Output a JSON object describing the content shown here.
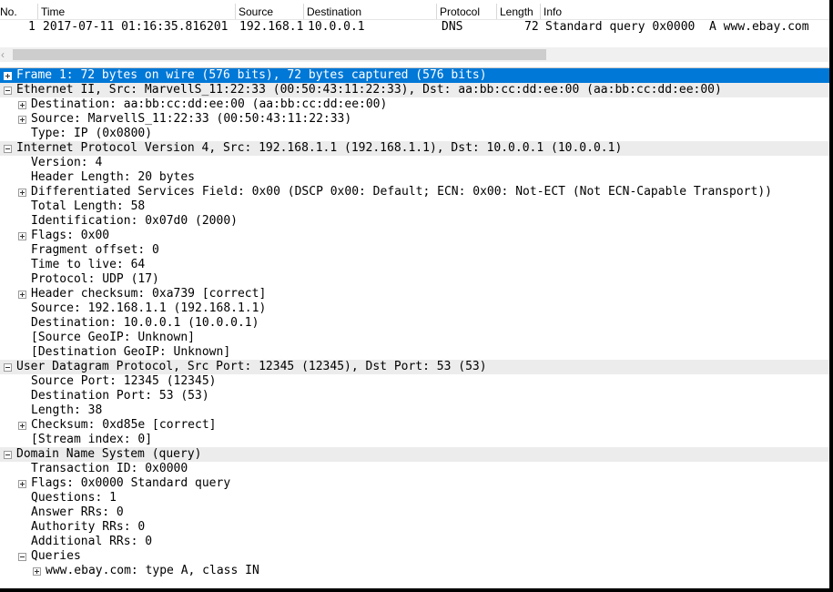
{
  "packet_list": {
    "columns": [
      "No.",
      "Time",
      "Source",
      "Destination",
      "Protocol",
      "Length",
      "Info"
    ],
    "row": {
      "no": "1",
      "time": "2017-07-11 01:16:35.816201",
      "source": "192.168.1.1",
      "destination": "10.0.0.1",
      "protocol": "DNS",
      "length": "72",
      "info": "Standard query 0x0000  A www.ebay.com"
    }
  },
  "scrollbar": {
    "left_arrow": "‹"
  },
  "details": [
    {
      "text": "Frame 1: 72 bytes on wire (576 bits), 72 bytes captured (576 bits)",
      "toggle": "plus",
      "level": 0,
      "selected": true
    },
    {
      "text": "Ethernet II, Src: MarvellS_11:22:33 (00:50:43:11:22:33), Dst: aa:bb:cc:dd:ee:00 (aa:bb:cc:dd:ee:00)",
      "toggle": "minus",
      "level": 0
    },
    {
      "text": "Destination: aa:bb:cc:dd:ee:00 (aa:bb:cc:dd:ee:00)",
      "toggle": "plus",
      "level": 1
    },
    {
      "text": "Source: MarvellS_11:22:33 (00:50:43:11:22:33)",
      "toggle": "plus",
      "level": 1
    },
    {
      "text": "Type: IP (0x0800)",
      "toggle": "none",
      "level": 1
    },
    {
      "text": "Internet Protocol Version 4, Src: 192.168.1.1 (192.168.1.1), Dst: 10.0.0.1 (10.0.0.1)",
      "toggle": "minus",
      "level": 0
    },
    {
      "text": "Version: 4",
      "toggle": "none",
      "level": 1
    },
    {
      "text": "Header Length: 20 bytes",
      "toggle": "none",
      "level": 1
    },
    {
      "text": "Differentiated Services Field: 0x00 (DSCP 0x00: Default; ECN: 0x00: Not-ECT (Not ECN-Capable Transport))",
      "toggle": "plus",
      "level": 1
    },
    {
      "text": "Total Length: 58",
      "toggle": "none",
      "level": 1
    },
    {
      "text": "Identification: 0x07d0 (2000)",
      "toggle": "none",
      "level": 1
    },
    {
      "text": "Flags: 0x00",
      "toggle": "plus",
      "level": 1
    },
    {
      "text": "Fragment offset: 0",
      "toggle": "none",
      "level": 1
    },
    {
      "text": "Time to live: 64",
      "toggle": "none",
      "level": 1
    },
    {
      "text": "Protocol: UDP (17)",
      "toggle": "none",
      "level": 1
    },
    {
      "text": "Header checksum: 0xa739 [correct]",
      "toggle": "plus",
      "level": 1
    },
    {
      "text": "Source: 192.168.1.1 (192.168.1.1)",
      "toggle": "none",
      "level": 1
    },
    {
      "text": "Destination: 10.0.0.1 (10.0.0.1)",
      "toggle": "none",
      "level": 1
    },
    {
      "text": "[Source GeoIP: Unknown]",
      "toggle": "none",
      "level": 1
    },
    {
      "text": "[Destination GeoIP: Unknown]",
      "toggle": "none",
      "level": 1
    },
    {
      "text": "User Datagram Protocol, Src Port: 12345 (12345), Dst Port: 53 (53)",
      "toggle": "minus",
      "level": 0
    },
    {
      "text": "Source Port: 12345 (12345)",
      "toggle": "none",
      "level": 1
    },
    {
      "text": "Destination Port: 53 (53)",
      "toggle": "none",
      "level": 1
    },
    {
      "text": "Length: 38",
      "toggle": "none",
      "level": 1
    },
    {
      "text": "Checksum: 0xd85e [correct]",
      "toggle": "plus",
      "level": 1
    },
    {
      "text": "[Stream index: 0]",
      "toggle": "none",
      "level": 1
    },
    {
      "text": "Domain Name System (query)",
      "toggle": "minus",
      "level": 0
    },
    {
      "text": "Transaction ID: 0x0000",
      "toggle": "none",
      "level": 1
    },
    {
      "text": "Flags: 0x0000 Standard query",
      "toggle": "plus",
      "level": 1
    },
    {
      "text": "Questions: 1",
      "toggle": "none",
      "level": 1
    },
    {
      "text": "Answer RRs: 0",
      "toggle": "none",
      "level": 1
    },
    {
      "text": "Authority RRs: 0",
      "toggle": "none",
      "level": 1
    },
    {
      "text": "Additional RRs: 0",
      "toggle": "none",
      "level": 1
    },
    {
      "text": "Queries",
      "toggle": "minus",
      "level": 1
    },
    {
      "text": "www.ebay.com: type A, class IN",
      "toggle": "plus",
      "level": 2
    }
  ],
  "colors": {
    "selection": "#0078d7",
    "top_level_row": "#ececec"
  }
}
